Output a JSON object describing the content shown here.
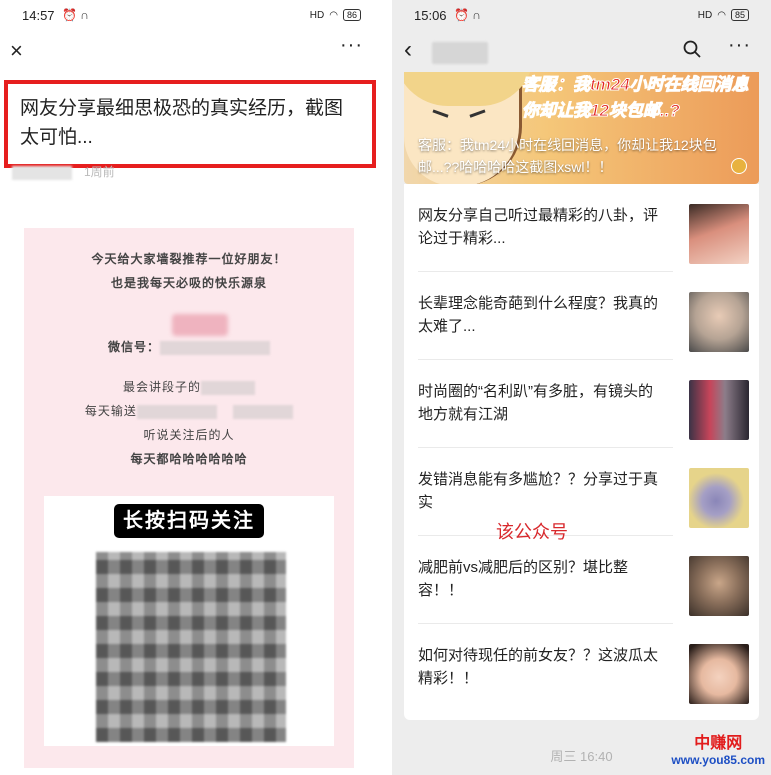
{
  "left": {
    "status": {
      "time": "14:57",
      "signal": "HD",
      "battery": "86"
    },
    "nav": {
      "close_icon": "×",
      "more_icon": "···"
    },
    "article": {
      "title": "网友分享最细思极恐的真实经历，截图太可怕...",
      "meta_time": "1周前"
    },
    "promo": {
      "line1": "今天给大家墙裂推荐一位好朋友！",
      "line2": "也是我每天必吸的快乐源泉",
      "wechat_label": "微信号：",
      "line4_prefix": "最会讲段子的",
      "line5_prefix": "每天输送",
      "line6": "听说关注后的人",
      "line7": "每天都哈哈哈哈哈哈",
      "qr_banner": "长按扫码关注"
    }
  },
  "right": {
    "status": {
      "time": "15:06",
      "signal": "HD",
      "battery": "85"
    },
    "nav": {
      "back_icon": "‹",
      "search_icon": "search",
      "more_icon": "···"
    },
    "cover": {
      "headline": "客服：我tm24小时在线回消息 你却让我12块包邮..?",
      "caption": "客服：我tm24小时在线回消息，你却让我12块包邮...??哈哈哈哈这截图xswl！！"
    },
    "items": [
      {
        "title": "网友分享自己听过最精彩的八卦，评论过于精彩...",
        "thumb_color": "#d98f7d"
      },
      {
        "title": "长辈理念能奇葩到什么程度？我真的太难了...",
        "thumb_color": "#b5a394"
      },
      {
        "title": "时尚圈的“名利趴”有多脏，有镜头的地方就有江湖",
        "thumb_color": "#8c7d8a"
      },
      {
        "title": "发错消息能有多尴尬？？分享过于真实",
        "thumb_color": "#e6d48a"
      },
      {
        "title": "减肥前vs减肥后的区别？堪比整容！！",
        "thumb_color": "#8a6f5b"
      },
      {
        "title": "如何对待现任的前女友？？这波瓜太精彩！！",
        "thumb_color": "#e6b9a0"
      }
    ],
    "overlay_label": "该公众号",
    "timestamp": "周三 16:40"
  },
  "watermark": {
    "cn": "中赚网",
    "url": "www.you85.com"
  }
}
